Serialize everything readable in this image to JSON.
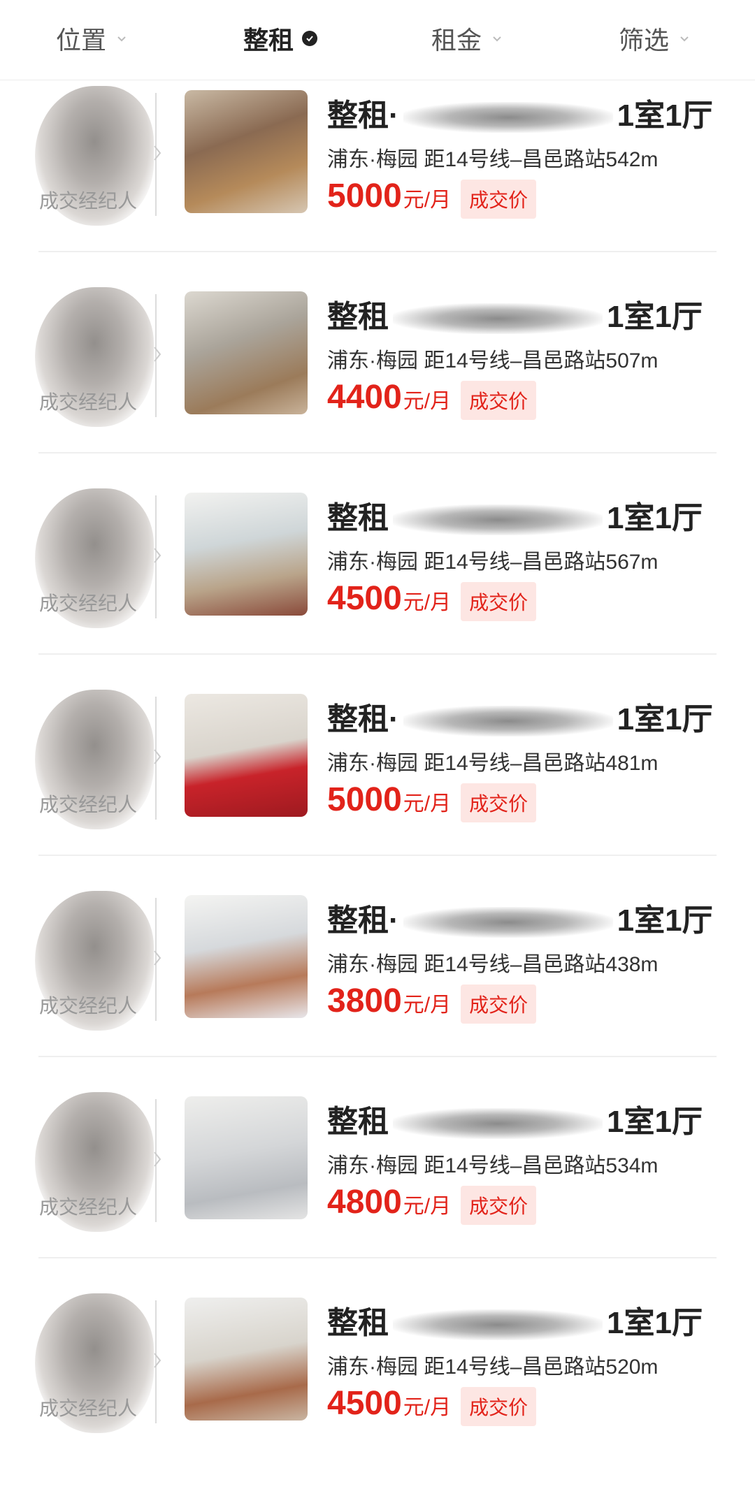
{
  "filter_bar": {
    "tabs": [
      {
        "label": "位置"
      },
      {
        "label": "整租"
      },
      {
        "label": "租金"
      },
      {
        "label": "筛选"
      }
    ]
  },
  "listings": [
    {
      "agent_caption": "成交经纪人",
      "title_prefix": "整租·",
      "title_suffix": "1室1厅",
      "location": "浦东·梅园 距14号线–昌邑路站542m",
      "price": "5000",
      "unit": "元/月",
      "badge": "成交价"
    },
    {
      "agent_caption": "成交经纪人",
      "title_prefix": "整租",
      "title_suffix": "1室1厅",
      "location": "浦东·梅园 距14号线–昌邑路站507m",
      "price": "4400",
      "unit": "元/月",
      "badge": "成交价"
    },
    {
      "agent_caption": "成交经纪人",
      "title_prefix": "整租",
      "title_suffix": "1室1厅",
      "location": "浦东·梅园 距14号线–昌邑路站567m",
      "price": "4500",
      "unit": "元/月",
      "badge": "成交价"
    },
    {
      "agent_caption": "成交经纪人",
      "title_prefix": "整租·",
      "title_suffix": "1室1厅",
      "location": "浦东·梅园 距14号线–昌邑路站481m",
      "price": "5000",
      "unit": "元/月",
      "badge": "成交价"
    },
    {
      "agent_caption": "成交经纪人",
      "title_prefix": "整租·",
      "title_suffix": "1室1厅",
      "location": "浦东·梅园 距14号线–昌邑路站438m",
      "price": "3800",
      "unit": "元/月",
      "badge": "成交价"
    },
    {
      "agent_caption": "成交经纪人",
      "title_prefix": "整租",
      "title_suffix": "1室1厅",
      "location": "浦东·梅园 距14号线–昌邑路站534m",
      "price": "4800",
      "unit": "元/月",
      "badge": "成交价"
    },
    {
      "agent_caption": "成交经纪人",
      "title_prefix": "整租",
      "title_suffix": "1室1厅",
      "location": "浦东·梅园 距14号线–昌邑路站520m",
      "price": "4500",
      "unit": "元/月",
      "badge": "成交价"
    }
  ],
  "colors": {
    "accent": "#e2231a",
    "badge_bg": "#fde6e3"
  },
  "icons": {
    "tab_dropdown": "chevron-down-icon",
    "tab_selected": "check-circle-icon",
    "agent_link": "chevron-right-icon"
  }
}
